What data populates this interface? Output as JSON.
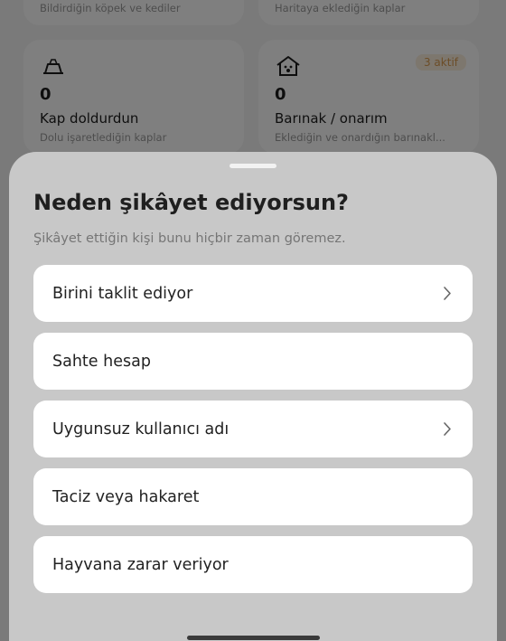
{
  "background": {
    "top_cards": [
      {
        "subtitle": "Bildirdiğin köpek ve kediler"
      },
      {
        "subtitle": "Haritaya eklediğin kaplar"
      }
    ],
    "cards": [
      {
        "icon": "food-bowl-icon",
        "count": "0",
        "title": "Kap doldurdun",
        "subtitle": "Dolu işaretlediğin kaplar"
      },
      {
        "icon": "shelter-house-icon",
        "count": "0",
        "title": "Barınak / onarım",
        "subtitle": "Eklediğin ve onardığın barınakl...",
        "badge": "3 aktif"
      }
    ]
  },
  "sheet": {
    "title": "Neden şikâyet ediyorsun?",
    "subtitle": "Şikâyet ettiğin kişi bunu hiçbir zaman göremez.",
    "options": [
      {
        "label": "Birini taklit ediyor",
        "has_chevron": true
      },
      {
        "label": "Sahte hesap",
        "has_chevron": false
      },
      {
        "label": "Uygunsuz kullanıcı adı",
        "has_chevron": true
      },
      {
        "label": "Taciz veya hakaret",
        "has_chevron": false
      },
      {
        "label": "Hayvana zarar veriyor",
        "has_chevron": false
      }
    ]
  },
  "colors": {
    "sheet_bg": "#c8c8c8",
    "option_bg": "#ffffff",
    "badge_text": "#d99a4e"
  }
}
